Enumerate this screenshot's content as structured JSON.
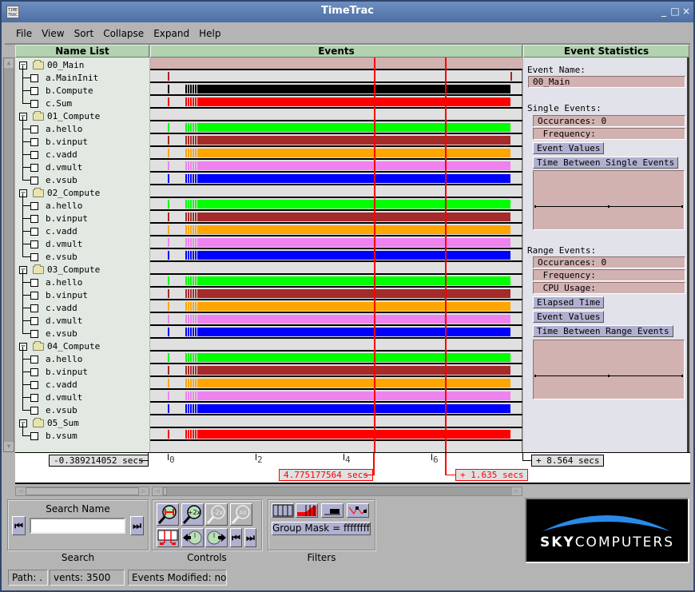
{
  "window": {
    "title": "TimeTrac",
    "app_icon_text": "TIME TRAC",
    "controls": {
      "minimize": "_",
      "maximize": "□",
      "close": "×"
    }
  },
  "menu": [
    "File",
    "View",
    "Sort",
    "Collapse",
    "Expand",
    "Help"
  ],
  "headers": {
    "name_list": "Name List",
    "events": "Events",
    "event_statistics": "Event Statistics"
  },
  "tree": [
    {
      "type": "group",
      "label": "00_Main"
    },
    {
      "type": "leaf",
      "label": "a.MainInit",
      "last": false
    },
    {
      "type": "leaf",
      "label": "b.Compute",
      "last": false
    },
    {
      "type": "leaf",
      "label": "c.Sum",
      "last": true
    },
    {
      "type": "group",
      "label": "01_Compute"
    },
    {
      "type": "leaf",
      "label": "a.hello",
      "last": false
    },
    {
      "type": "leaf",
      "label": "b.vinput",
      "last": false
    },
    {
      "type": "leaf",
      "label": "c.vadd",
      "last": false
    },
    {
      "type": "leaf",
      "label": "d.vmult",
      "last": false
    },
    {
      "type": "leaf",
      "label": "e.vsub",
      "last": true
    },
    {
      "type": "group",
      "label": "02_Compute"
    },
    {
      "type": "leaf",
      "label": "a.hello",
      "last": false
    },
    {
      "type": "leaf",
      "label": "b.vinput",
      "last": false
    },
    {
      "type": "leaf",
      "label": "c.vadd",
      "last": false
    },
    {
      "type": "leaf",
      "label": "d.vmult",
      "last": false
    },
    {
      "type": "leaf",
      "label": "e.vsub",
      "last": true
    },
    {
      "type": "group",
      "label": "03_Compute"
    },
    {
      "type": "leaf",
      "label": "a.hello",
      "last": false
    },
    {
      "type": "leaf",
      "label": "b.vinput",
      "last": false
    },
    {
      "type": "leaf",
      "label": "c.vadd",
      "last": false
    },
    {
      "type": "leaf",
      "label": "d.vmult",
      "last": false
    },
    {
      "type": "leaf",
      "label": "e.vsub",
      "last": true
    },
    {
      "type": "group",
      "label": "04_Compute"
    },
    {
      "type": "leaf",
      "label": "a.hello",
      "last": false
    },
    {
      "type": "leaf",
      "label": "b.vinput",
      "last": false
    },
    {
      "type": "leaf",
      "label": "c.vadd",
      "last": false
    },
    {
      "type": "leaf",
      "label": "d.vmult",
      "last": false
    },
    {
      "type": "leaf",
      "label": "e.vsub",
      "last": true
    },
    {
      "type": "group",
      "label": "05_Sum"
    },
    {
      "type": "leaf",
      "label": "b.vsum",
      "last": true
    }
  ],
  "event_colors": {
    "a.MainInit": "#b22222",
    "b.Compute": "#000000",
    "c.Sum": "#ff0000",
    "a.hello": "#00ff00",
    "b.vinput": "#a52a2a",
    "c.vadd": "#ffa500",
    "d.vmult": "#ee82ee",
    "e.vsub": "#0000ff",
    "b.vsum": "#ff0000"
  },
  "event_timeline": {
    "start_secs": -0.389214052,
    "end_secs": 8.564,
    "ticks": [
      "0",
      "2",
      "4",
      "6"
    ],
    "tick_values": [
      0,
      2,
      4,
      6
    ],
    "cursor1_secs": 4.775177564,
    "cursor2_delta_secs": 1.635,
    "activity_start_secs": 0.4,
    "activity_end_secs": 7.8
  },
  "timeline_labels": {
    "start": "-0.389214052 secs",
    "end": "+ 8.564 secs",
    "cursor1": "4.775177564 secs",
    "cursor2": "+ 1.635 secs"
  },
  "stats": {
    "event_name_label": "Event Name:",
    "event_name_value": "00_Main",
    "single_events_label": "Single Events:",
    "single_occurances": "Occurances: 0",
    "single_frequency": " Frequency:",
    "event_values_btn": "Event Values",
    "time_between_single_btn": "Time Between Single Events",
    "range_events_label": "Range Events:",
    "range_occurances": "Occurances: 0",
    "range_frequency": " Frequency:",
    "range_cpu": " CPU Usage:",
    "elapsed_time_btn": "Elapsed Time",
    "range_event_values_btn": "Event Values",
    "time_between_range_btn": "Time Between Range Events"
  },
  "search": {
    "title": "Search Name",
    "caption": "Search",
    "value": "",
    "prev": "◀",
    "next": "▶"
  },
  "controls": {
    "caption": "Controls",
    "zoom_2x_in": "+2x",
    "zoom_2x_out": "-2x",
    "zoom_all": "All"
  },
  "filters": {
    "caption": "Filters",
    "group_mask": "Group Mask = ffffffff"
  },
  "logo": {
    "text_bold": "SKY",
    "text_light": "COMPUTERS"
  },
  "status": {
    "path": "Path: .",
    "events": "vents: 3500",
    "modified": "Events Modified: no"
  }
}
